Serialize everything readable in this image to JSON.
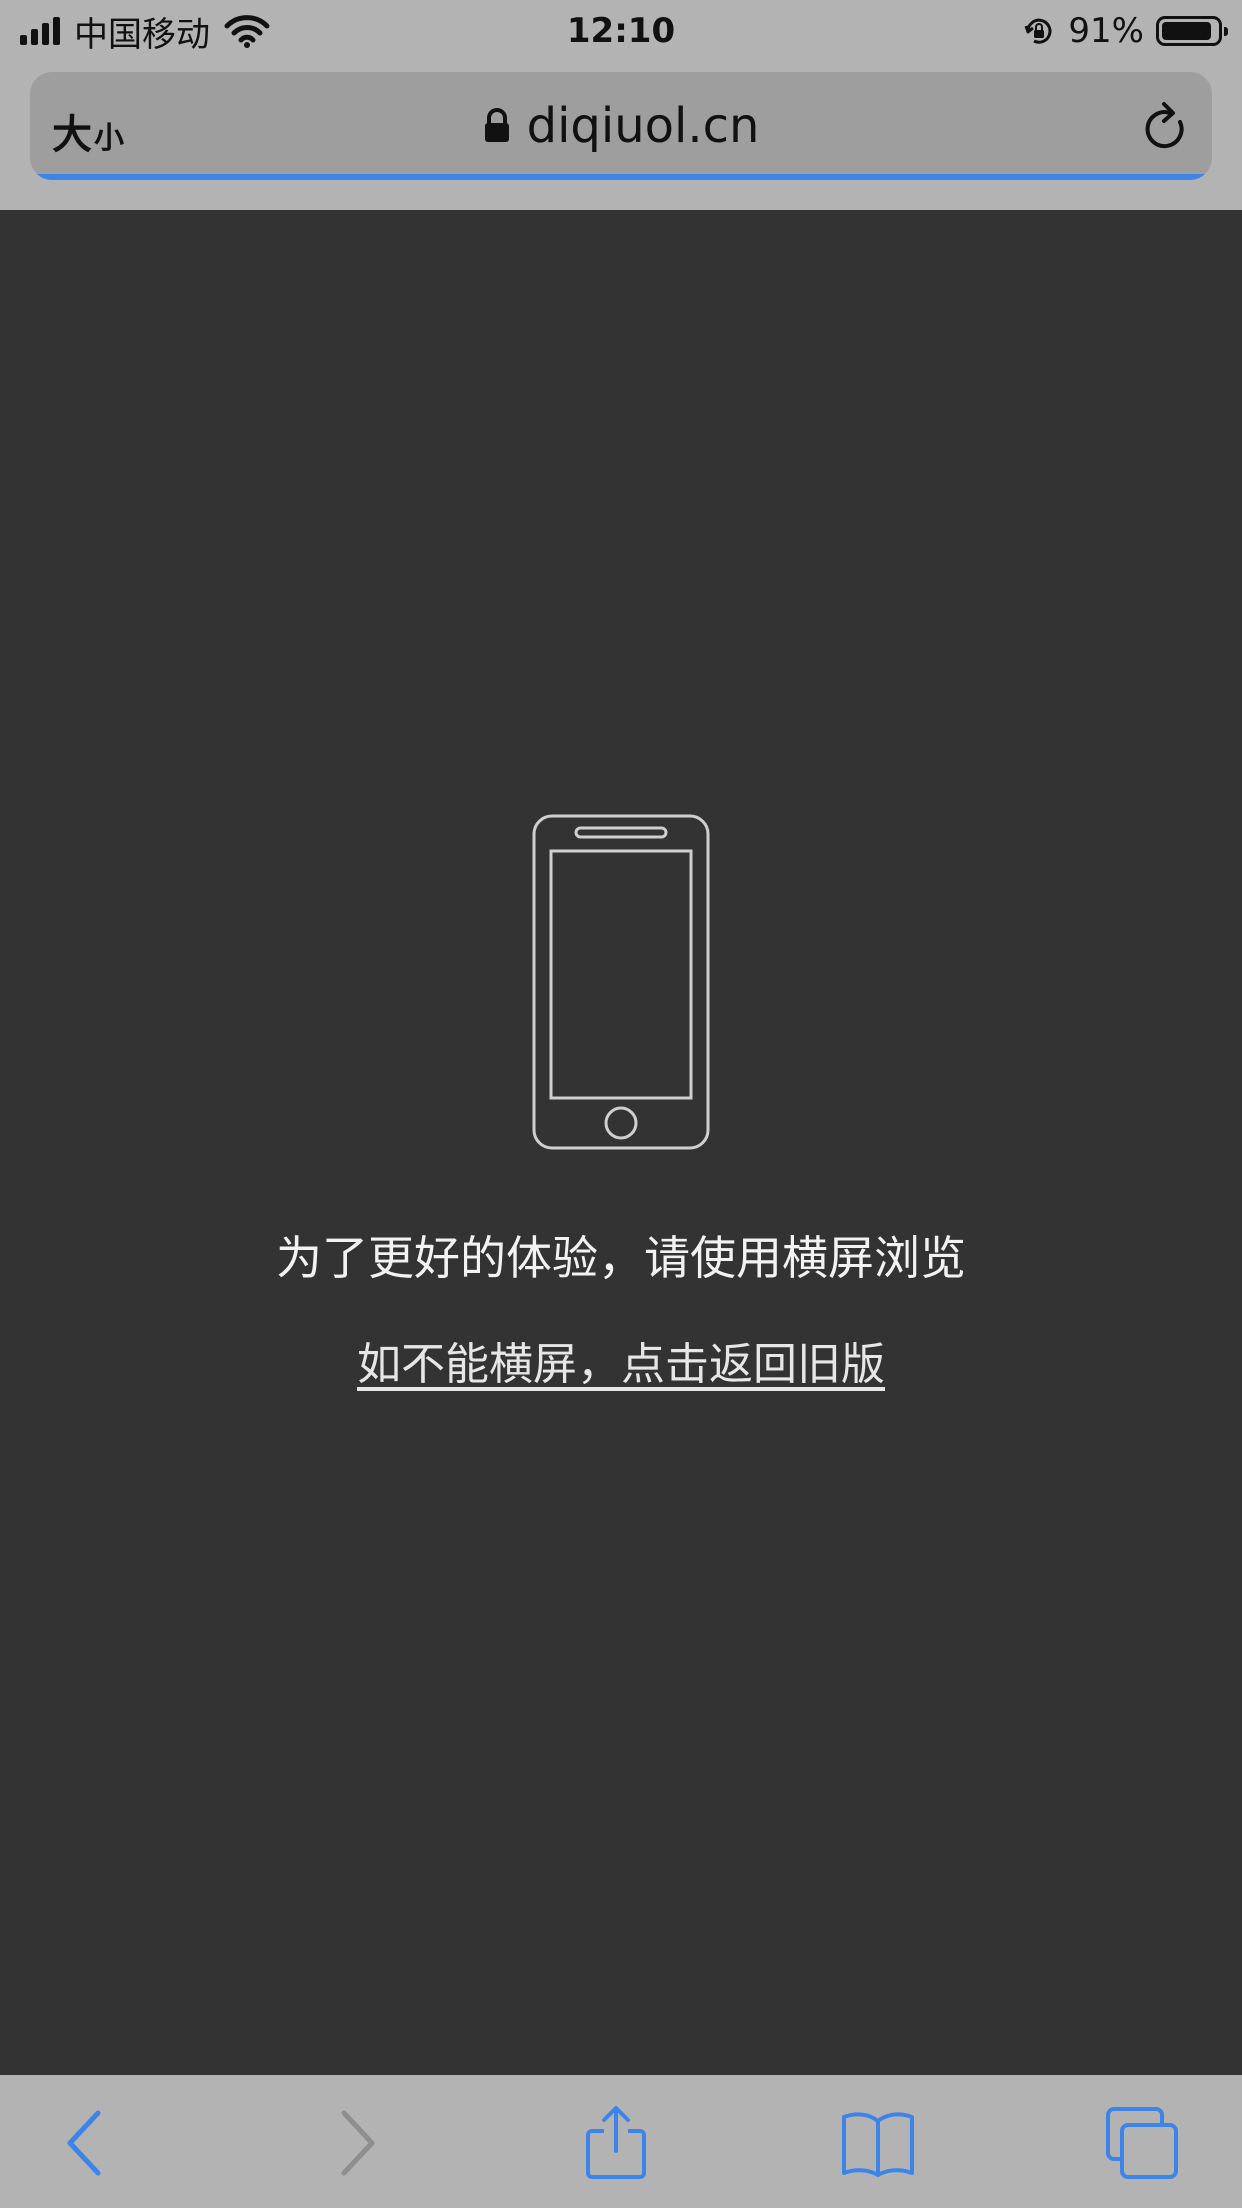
{
  "status_bar": {
    "carrier": "中国移动",
    "time": "12:10",
    "battery_percent": "91%",
    "battery_level": 0.91,
    "icons": [
      "signal-icon",
      "wifi-icon",
      "orientation-lock-icon",
      "battery-icon"
    ]
  },
  "browser": {
    "text_size_big": "大",
    "text_size_small": "小",
    "url": "diqiuol.cn",
    "load_progress": 1.0,
    "accent_color": "#3d84e8",
    "icons": [
      "padlock-icon",
      "reload-icon"
    ]
  },
  "page": {
    "message": "为了更好的体验，请使用横屏浏览",
    "fallback_link": "如不能横屏，点击返回旧版",
    "background_color": "#333333",
    "icons": [
      "phone-rotate-icon"
    ]
  },
  "toolbar": {
    "icons": [
      "back-icon",
      "forward-icon",
      "share-icon",
      "bookmarks-icon",
      "tabs-icon"
    ],
    "forward_enabled": false
  }
}
